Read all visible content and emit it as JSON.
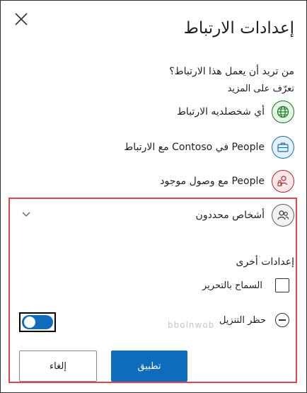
{
  "dialog": {
    "title": "إعدادات الارتباط",
    "close_icon": "close-icon"
  },
  "audience": {
    "question": "من تريد أن يعمل هذا الارتباط؟",
    "learn_more": "تعرّف على المزيد",
    "options": [
      {
        "label": "أي شخصلديه الارتباط",
        "icon": "globe-icon",
        "color": "#107c10"
      },
      {
        "label": "People في Contoso مع الارتباط",
        "icon": "briefcase-icon",
        "color": "#0f6cbd"
      },
      {
        "label": "People مع وصول موجود",
        "icon": "people-lock-icon",
        "color": "#a4262c"
      },
      {
        "label": "أشخاص محددون",
        "icon": "people-icon",
        "color": "#605e5c"
      }
    ]
  },
  "other_settings": {
    "title": "إعدادات أخرى",
    "allow_editing": {
      "label": "السماح بالتحرير",
      "checked": false
    },
    "block_download": {
      "label": "حظر التنزيل",
      "ghost_text": "bbolnwob",
      "toggle_on": true
    }
  },
  "buttons": {
    "apply": "تطبيق",
    "cancel": "إلغاء"
  },
  "colors": {
    "accent": "#0f6cbd",
    "highlight_border": "#e0474c"
  }
}
